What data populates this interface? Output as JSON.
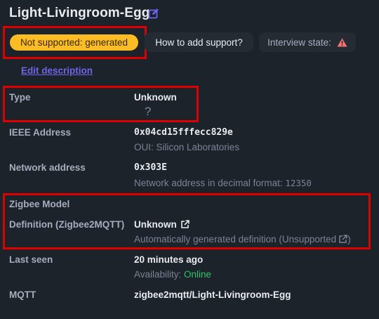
{
  "device": {
    "title": "Light-Livingroom-Egg"
  },
  "header": {
    "support_badge": "Not supported: generated",
    "how_to_button": "How to add support?",
    "interview_label": "Interview state:",
    "edit_description": "Edit description"
  },
  "rows": {
    "type_label": "Type",
    "type_value": "Unknown",
    "type_icon_glyph": "?",
    "ieee_label": "IEEE Address",
    "ieee_value": "0x04cd15fffecc829e",
    "ieee_sub": "OUI: Silicon Laboratories",
    "network_label": "Network address",
    "network_value": "0x303E",
    "network_sub_prefix": "Network address in decimal format: ",
    "network_sub_value": "12350",
    "zigbee_model_label": "Zigbee Model",
    "definition_label": "Definition (Zigbee2MQTT)",
    "definition_value": "Unknown",
    "definition_sub": "Automatically generated definition (Unsupported",
    "definition_sub_close": ")",
    "last_seen_label": "Last seen",
    "last_seen_value": "20 minutes ago",
    "availability_label": "Availability: ",
    "availability_value": "Online",
    "mqtt_label": "MQTT",
    "mqtt_value": "zigbee2mqtt/Light-Livingroom-Egg"
  },
  "colors": {
    "background": "#1d232a",
    "warning": "#fbbd23",
    "link": "#7065e8",
    "online": "#27c46c",
    "alert": "#f87272",
    "highlight": "#e00000"
  },
  "icons": {
    "edit": "edit-icon",
    "alert": "warning-triangle-icon",
    "external": "external-link-icon",
    "question": "question-mark-icon"
  }
}
